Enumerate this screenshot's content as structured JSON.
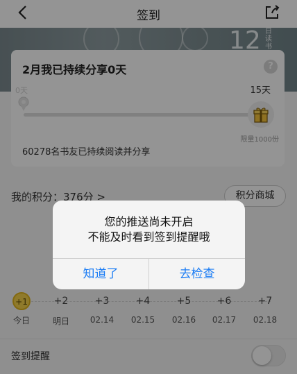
{
  "nav": {
    "title": "签到",
    "back_icon": "back-arrow-icon",
    "share_icon": "share-icon"
  },
  "banner": {
    "day_number": "12",
    "vertical_text": [
      "日",
      "读",
      "书"
    ]
  },
  "card": {
    "title": "2月我已持续分享0天",
    "start_label": "0天",
    "end_label": "15天",
    "progress": 0,
    "gift_label": "限量1000份",
    "readers_text": "60278名书友已持续阅读并分享"
  },
  "points": {
    "label": "我的积分：376分 >",
    "mall_button": "积分商城"
  },
  "days": [
    {
      "bonus": "+1",
      "label": "今日",
      "active": true
    },
    {
      "bonus": "+2",
      "label": "明日",
      "active": false
    },
    {
      "bonus": "+3",
      "label": "02.14",
      "active": false
    },
    {
      "bonus": "+4",
      "label": "02.15",
      "active": false
    },
    {
      "bonus": "+5",
      "label": "02.16",
      "active": false
    },
    {
      "bonus": "+6",
      "label": "02.17",
      "active": false
    },
    {
      "bonus": "+7",
      "label": "02.18",
      "active": false
    }
  ],
  "reminder": {
    "label": "签到提醒",
    "enabled": false
  },
  "dialog": {
    "line1": "您的推送尚未开启",
    "line2": "不能及时看到签到提醒哦",
    "cancel": "知道了",
    "confirm": "去检查"
  },
  "colors": {
    "accent": "#1a7cf5",
    "gold": "#f7d34a"
  }
}
